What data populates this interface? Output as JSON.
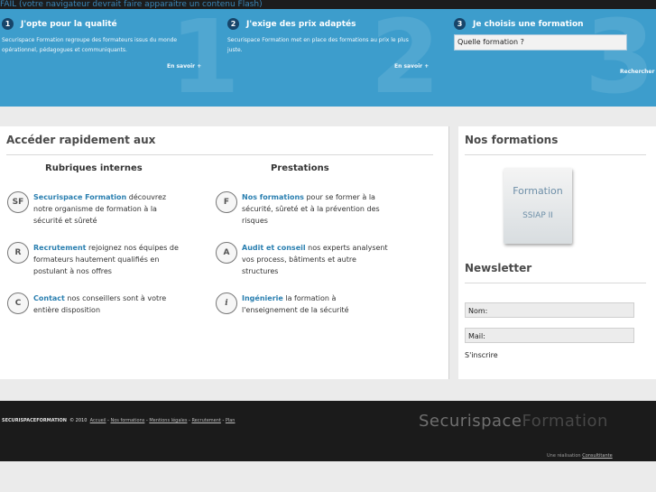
{
  "flash_message": "FAIL (votre navigateur devrait faire apparaitre un contenu Flash)",
  "banner": {
    "big_numbers": [
      "1",
      "2",
      "3"
    ],
    "columns": [
      {
        "number": "1",
        "title": "J'opte pour la qualité",
        "text": "Securispace Formation regroupe des formateurs issus du monde opérationnel, pédagogues et communiquants.",
        "more": "En savoir +"
      },
      {
        "number": "2",
        "title": "J'exige des prix adaptés",
        "text": "Securispace Formation met en place des formations au prix le plus juste.",
        "more": "En savoir +"
      },
      {
        "number": "3",
        "title": "Je choisis une formation",
        "input_value": "Quelle formation ?",
        "search_label": "Rechercher"
      }
    ]
  },
  "quick_access": {
    "title": "Accéder rapidement aux",
    "columns": [
      {
        "heading": "Rubriques internes",
        "items": [
          {
            "icon": "SF",
            "icon_name": "sf-icon",
            "link": "Securispace Formation",
            "text": " découvrez notre organisme de formation à la sécurité et sûreté"
          },
          {
            "icon": "R",
            "icon_name": "r-icon",
            "link": "Recrutement",
            "text": " rejoignez nos équipes de formateurs hautement qualifiés en postulant à nos offres"
          },
          {
            "icon": "C",
            "icon_name": "c-icon",
            "link": "Contact",
            "text": " nos conseillers sont à votre entière disposition"
          }
        ]
      },
      {
        "heading": "Prestations",
        "items": [
          {
            "icon": "F",
            "icon_name": "f-icon",
            "link": "Nos formations",
            "text": " pour se former à la sécurité, sûreté et à la prévention des risques"
          },
          {
            "icon": "A",
            "icon_name": "a-icon",
            "link": "Audit et conseil",
            "text": " nos experts analysent vos process, bâtiments et autre structures"
          },
          {
            "icon": "i",
            "icon_name": "info-icon",
            "link": "Ingénierie",
            "text": " la formation à l'enseignement de la sécurité"
          }
        ]
      }
    ]
  },
  "formations": {
    "title": "Nos formations",
    "promo_line1": "Formation",
    "promo_line2": "SSIAP II"
  },
  "newsletter": {
    "title": "Newsletter",
    "name_field": "Nom:",
    "mail_field": "Mail:",
    "submit": "S'inscrire"
  },
  "footer": {
    "brand": "SECURISPACEFORMATION",
    "copyright": "© 2010",
    "links": [
      "Accueil",
      "Nos formations",
      "Mentions légales",
      "Recrutement",
      "Plan"
    ],
    "logo_bold": "Securispace",
    "logo_thin": "Formation",
    "credit_prefix": "Une réalisation",
    "credit_link": "Consultitante"
  },
  "colors": {
    "banner_bg": "#3d9dcc",
    "accent_link": "#2a7fb0",
    "footer_bg": "#1b1b1b",
    "page_bg": "#ebebeb"
  }
}
